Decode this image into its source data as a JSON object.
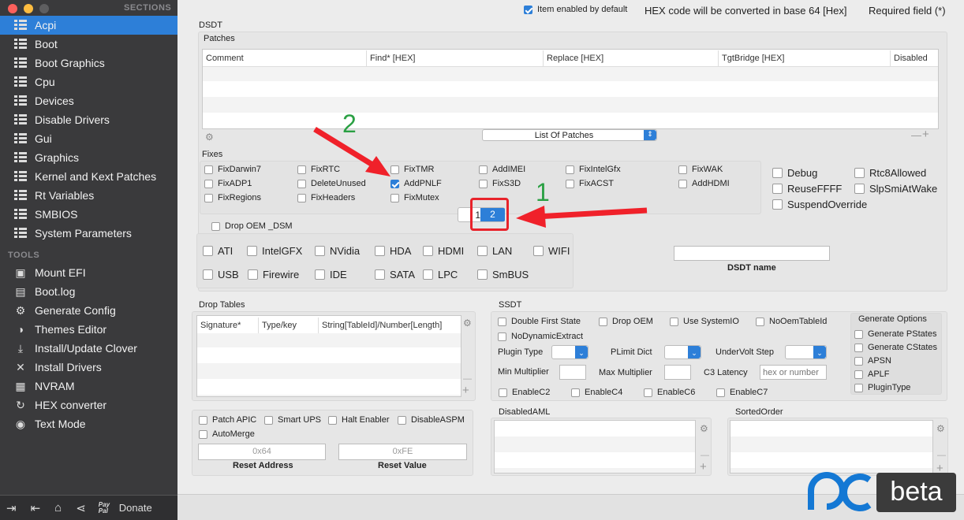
{
  "sidebar": {
    "sections_label": "SECTIONS",
    "tools_label": "TOOLS",
    "sections": [
      "Acpi",
      "Boot",
      "Boot Graphics",
      "Cpu",
      "Devices",
      "Disable Drivers",
      "Gui",
      "Graphics",
      "Kernel and Kext Patches",
      "Rt Variables",
      "SMBIOS",
      "System Parameters"
    ],
    "tools": [
      {
        "label": "Mount EFI",
        "icon": "disk-icon"
      },
      {
        "label": "Boot.log",
        "icon": "document-icon"
      },
      {
        "label": "Generate Config",
        "icon": "gear-icon"
      },
      {
        "label": "Themes Editor",
        "icon": "palette-icon"
      },
      {
        "label": "Install/Update Clover",
        "icon": "download-icon"
      },
      {
        "label": "Install Drivers",
        "icon": "tools-icon"
      },
      {
        "label": "NVRAM",
        "icon": "chip-icon"
      },
      {
        "label": "HEX converter",
        "icon": "refresh-icon"
      },
      {
        "label": "Text Mode",
        "icon": "eye-icon"
      }
    ],
    "donate_label": "Donate",
    "paypal_label": "Pay Pal"
  },
  "header": {
    "item_enabled": "Item enabled by default",
    "hex_note": "HEX code will be converted in base 64 [Hex]",
    "required": "Required field (*)"
  },
  "dsdt": {
    "title": "DSDT",
    "patches_label": "Patches",
    "columns": [
      "Comment",
      "Find* [HEX]",
      "Replace [HEX]",
      "TgtBridge [HEX]",
      "Disabled"
    ],
    "list_select": "List Of Patches",
    "fixes_label": "Fixes",
    "fixes": [
      {
        "label": "FixDarwin7",
        "checked": false
      },
      {
        "label": "FixRTC",
        "checked": false
      },
      {
        "label": "FixTMR",
        "checked": false
      },
      {
        "label": "AddIMEI",
        "checked": false
      },
      {
        "label": "FixIntelGfx",
        "checked": false
      },
      {
        "label": "FixWAK",
        "checked": false
      },
      {
        "label": "FixADP1",
        "checked": false
      },
      {
        "label": "DeleteUnused",
        "checked": false
      },
      {
        "label": "AddPNLF",
        "checked": true
      },
      {
        "label": "FixS3D",
        "checked": false
      },
      {
        "label": "FixACST",
        "checked": false
      },
      {
        "label": "AddHDMI",
        "checked": false
      },
      {
        "label": "FixRegions",
        "checked": false
      },
      {
        "label": "FixHeaders",
        "checked": false
      },
      {
        "label": "FixMutex",
        "checked": false
      }
    ],
    "side_options": [
      "Debug",
      "Rtc8Allowed",
      "ReuseFFFF",
      "SlpSmiAtWake",
      "SuspendOverride"
    ],
    "pages": [
      "1",
      "2"
    ],
    "drop_oem": "Drop OEM _DSM",
    "dsm_row1": [
      "ATI",
      "IntelGFX",
      "NVidia",
      "HDA",
      "HDMI",
      "LAN",
      "WIFI"
    ],
    "dsm_row2": [
      "USB",
      "Firewire",
      "IDE",
      "SATA",
      "LPC",
      "SmBUS"
    ],
    "dsdt_name_label": "DSDT name",
    "dsdt_name_value": ""
  },
  "drop_tables": {
    "title": "Drop Tables",
    "columns": [
      "Signature*",
      "Type/key",
      "String[TableId]/Number[Length]"
    ]
  },
  "ssdt": {
    "title": "SSDT",
    "row1": [
      "Double First State",
      "Drop OEM",
      "Use SystemIO",
      "NoOemTableId"
    ],
    "no_dynamic": "NoDynamicExtract",
    "plugin_type": "Plugin Type",
    "plimit": "PLimit Dict",
    "undervolt": "UnderVolt Step",
    "min_mult": "Min Multiplier",
    "max_mult": "Max Multiplier",
    "c3_latency": "C3 Latency",
    "c3_placeholder": "hex or number",
    "enable": [
      "EnableC2",
      "EnableC4",
      "EnableC6",
      "EnableC7"
    ],
    "gen_title": "Generate Options",
    "gen": [
      "Generate PStates",
      "Generate CStates",
      "APSN",
      "APLF",
      "PluginType"
    ]
  },
  "misc": {
    "options": [
      "Patch APIC",
      "Smart UPS",
      "Halt Enabler",
      "DisableASPM"
    ],
    "automerge": "AutoMerge",
    "reset_address_value": "0x64",
    "reset_value_value": "0xFE",
    "reset_address_label": "Reset Address",
    "reset_value_label": "Reset Value"
  },
  "disabled_aml": {
    "title": "DisabledAML"
  },
  "sorted_order": {
    "title": "SortedOrder"
  },
  "annotations": {
    "step1": "1",
    "step2": "2"
  },
  "watermark": {
    "text": "beta"
  },
  "colors": {
    "accent": "#2d7fd8",
    "sidebar": "#3a3a3c",
    "annotation_arrow": "#f0212a",
    "annotation_number": "#2aa043"
  }
}
